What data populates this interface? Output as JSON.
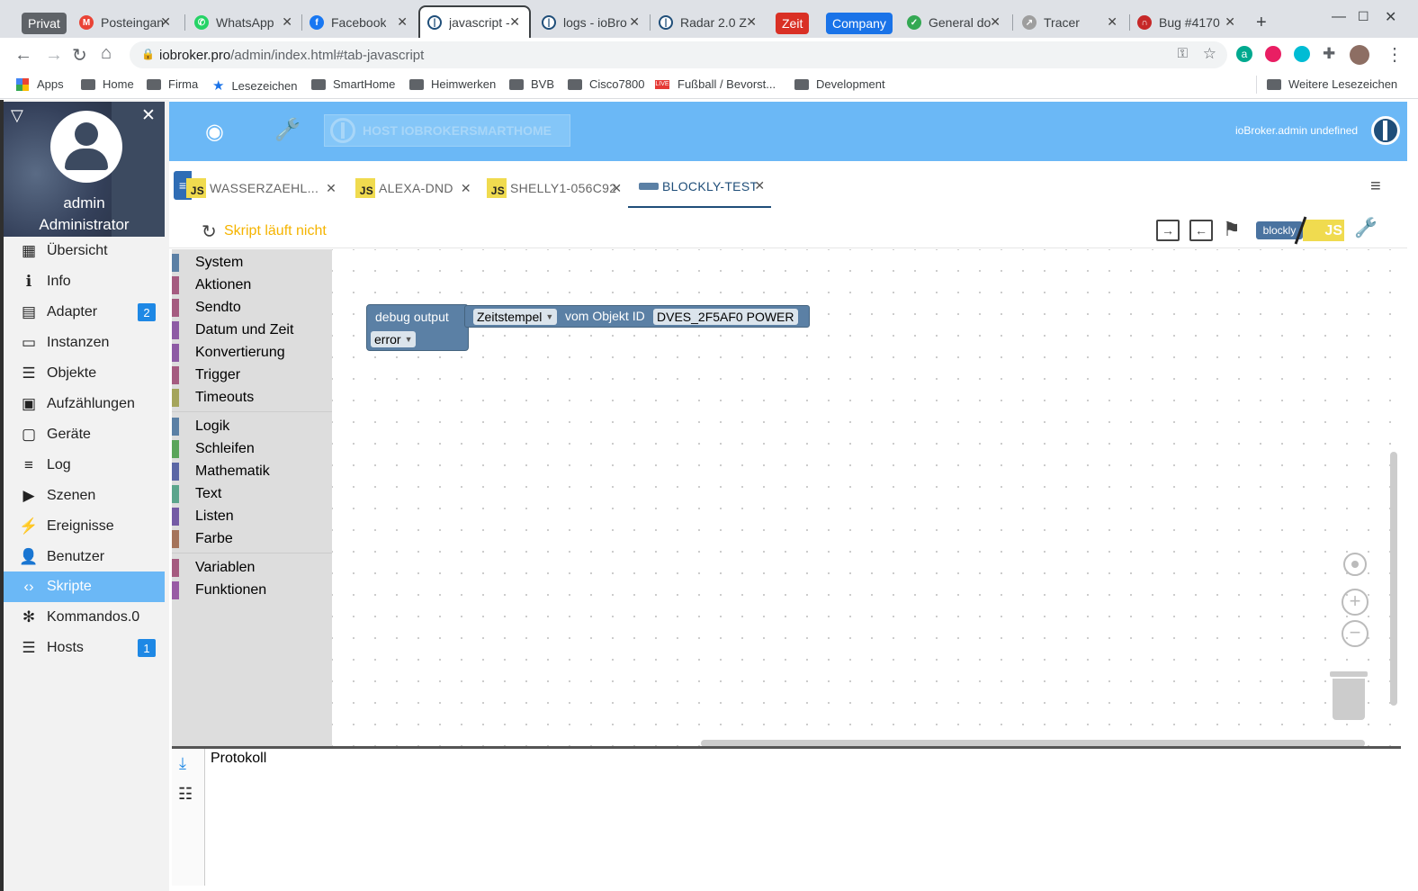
{
  "browser": {
    "tabs": [
      {
        "label": "Privat",
        "kind": "profile"
      },
      {
        "label": "Posteingan",
        "icon": "gmail-icon"
      },
      {
        "label": "WhatsApp",
        "icon": "whatsapp-icon"
      },
      {
        "label": "Facebook",
        "icon": "facebook-icon"
      },
      {
        "label": "javascript -",
        "icon": "iobroker-icon",
        "active": true
      },
      {
        "label": "logs - ioBro",
        "icon": "iobroker-icon"
      },
      {
        "label": "Radar 2.0 Z",
        "icon": "iobroker-icon"
      },
      {
        "label": "Zeit",
        "kind": "pill",
        "color": "#d93025"
      },
      {
        "label": "Company",
        "kind": "pill",
        "color": "#1a73e8"
      },
      {
        "label": "General do",
        "icon": "general-icon"
      },
      {
        "label": "Tracer",
        "icon": "tracer-icon"
      },
      {
        "label": "Bug #4170",
        "icon": "bug-icon"
      }
    ],
    "url_host": "iobroker.pro",
    "url_path": "/admin/index.html#tab-javascript",
    "bookmarks": [
      "Apps",
      "Home",
      "Firma",
      "Lesezeichen",
      "SmartHome",
      "Heimwerken",
      "BVB",
      "Cisco7800",
      "Fußball / Bevorst...",
      "Development",
      "Weitere Lesezeichen"
    ]
  },
  "profile": {
    "name": "admin",
    "role": "Administrator"
  },
  "menu": [
    {
      "label": "Übersicht",
      "icon": "grid-icon",
      "glyph": "▦"
    },
    {
      "label": "Info",
      "icon": "info-icon",
      "glyph": "ℹ"
    },
    {
      "label": "Adapter",
      "icon": "store-icon",
      "glyph": "▤",
      "badge": "2"
    },
    {
      "label": "Instanzen",
      "icon": "instances-icon",
      "glyph": "▭"
    },
    {
      "label": "Objekte",
      "icon": "list-icon",
      "glyph": "☰"
    },
    {
      "label": "Aufzählungen",
      "icon": "enums-icon",
      "glyph": "▣"
    },
    {
      "label": "Geräte",
      "icon": "devices-icon",
      "glyph": "▢"
    },
    {
      "label": "Log",
      "icon": "log-icon",
      "glyph": "≡"
    },
    {
      "label": "Szenen",
      "icon": "scenes-icon",
      "glyph": "▶"
    },
    {
      "label": "Ereignisse",
      "icon": "bolt-icon",
      "glyph": "⚡"
    },
    {
      "label": "Benutzer",
      "icon": "user-icon",
      "glyph": "👤"
    },
    {
      "label": "Skripte",
      "icon": "code-icon",
      "glyph": "‹›",
      "selected": true
    },
    {
      "label": "Kommandos.0",
      "icon": "snowflake-icon",
      "glyph": "✻"
    },
    {
      "label": "Hosts",
      "icon": "hosts-icon",
      "glyph": "☰",
      "badge": "1"
    }
  ],
  "header": {
    "host": "HOST IOBROKERSMARTHOME",
    "user": "ioBroker.admin undefined"
  },
  "script_tabs": [
    {
      "label": "WASSERZAEHL...",
      "type": "js"
    },
    {
      "label": "ALEXA-DND",
      "type": "js"
    },
    {
      "label": "SHELLY1-056C92",
      "type": "js"
    },
    {
      "label": "BLOCKLY-TEST",
      "type": "blockly",
      "active": true
    }
  ],
  "toolbar": {
    "status": "Skript läuft nicht",
    "blockly_label": "blockly",
    "js_label": "JS"
  },
  "toolbox": {
    "group1": [
      {
        "label": "System",
        "color": "#5b80a5"
      },
      {
        "label": "Aktionen",
        "color": "#a55b80"
      },
      {
        "label": "Sendto",
        "color": "#a55b80"
      },
      {
        "label": "Datum und Zeit",
        "color": "#8e5ba5"
      },
      {
        "label": "Konvertierung",
        "color": "#8e5ba5"
      },
      {
        "label": "Trigger",
        "color": "#a55b80"
      },
      {
        "label": "Timeouts",
        "color": "#a5a55b"
      }
    ],
    "group2": [
      {
        "label": "Logik",
        "color": "#5b80a5"
      },
      {
        "label": "Schleifen",
        "color": "#5ba55b"
      },
      {
        "label": "Mathematik",
        "color": "#5b67a5"
      },
      {
        "label": "Text",
        "color": "#5ba58c"
      },
      {
        "label": "Listen",
        "color": "#745ba5"
      },
      {
        "label": "Farbe",
        "color": "#a5745b"
      }
    ],
    "group3": [
      {
        "label": "Variablen",
        "color": "#a55b80"
      },
      {
        "label": "Funktionen",
        "color": "#995ba5"
      }
    ]
  },
  "block": {
    "debug_label": "debug output",
    "timestamp_option": "Zeitstempel",
    "object_label": "vom Objekt ID",
    "object_id": "DVES_2F5AF0 POWER",
    "level_option": "error"
  },
  "log": {
    "title": "Protokoll"
  }
}
